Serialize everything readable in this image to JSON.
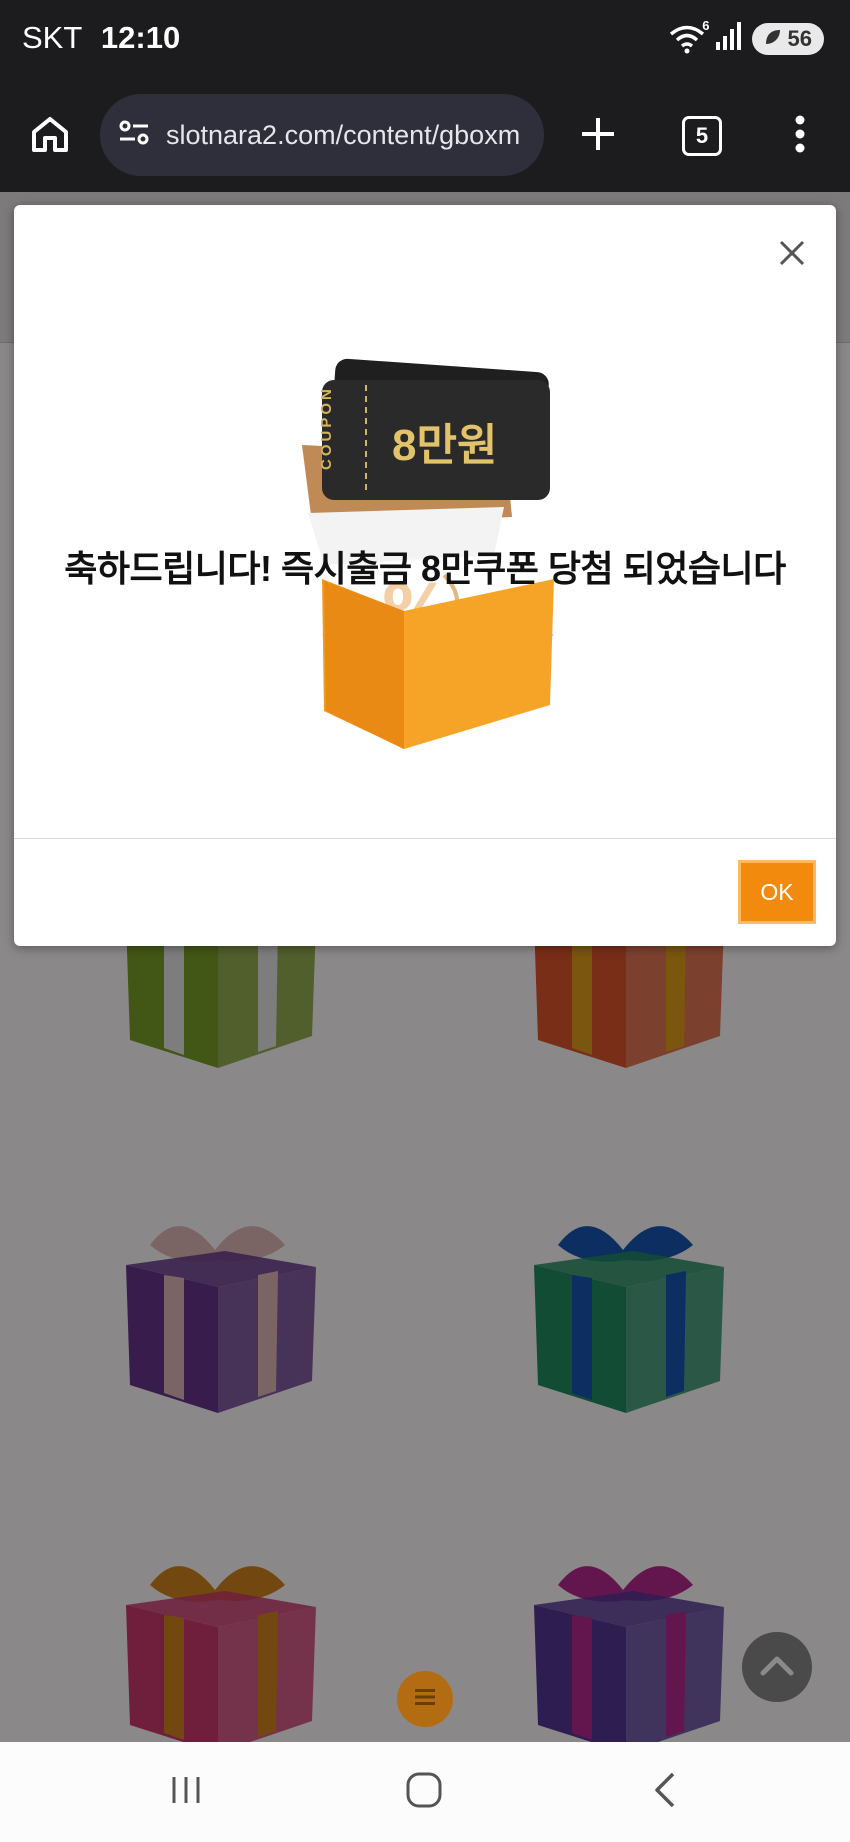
{
  "status_bar": {
    "carrier": "SKT",
    "time": "12:10",
    "wifi_badge": "6",
    "battery": "56"
  },
  "browser": {
    "url": "slotnara2.com/content/gboxm",
    "tab_count": "5"
  },
  "modal": {
    "coupon_label": "COUPON",
    "coupon_amount": "8만원",
    "message": "축하드립니다! 즉시출금 8만쿠폰 당첨 되었습니다",
    "ok_label": "OK"
  },
  "gift_boxes": [
    {
      "box_color": "#6a8a22",
      "ribbon_color": "#c9c9c9"
    },
    {
      "box_color": "#c24a25",
      "ribbon_color": "#c58a18"
    },
    {
      "box_color": "#5a2f7a",
      "ribbon_color": "#c7a2a2"
    },
    {
      "box_color": "#1f7a55",
      "ribbon_color": "#144b9c"
    },
    {
      "box_color": "#b3315f",
      "ribbon_color": "#b9721a"
    },
    {
      "box_color": "#4a2f82",
      "ribbon_color": "#a0237e"
    }
  ],
  "colors": {
    "accent_orange": "#f28a0d",
    "dim_overlay": "#8a8889"
  }
}
